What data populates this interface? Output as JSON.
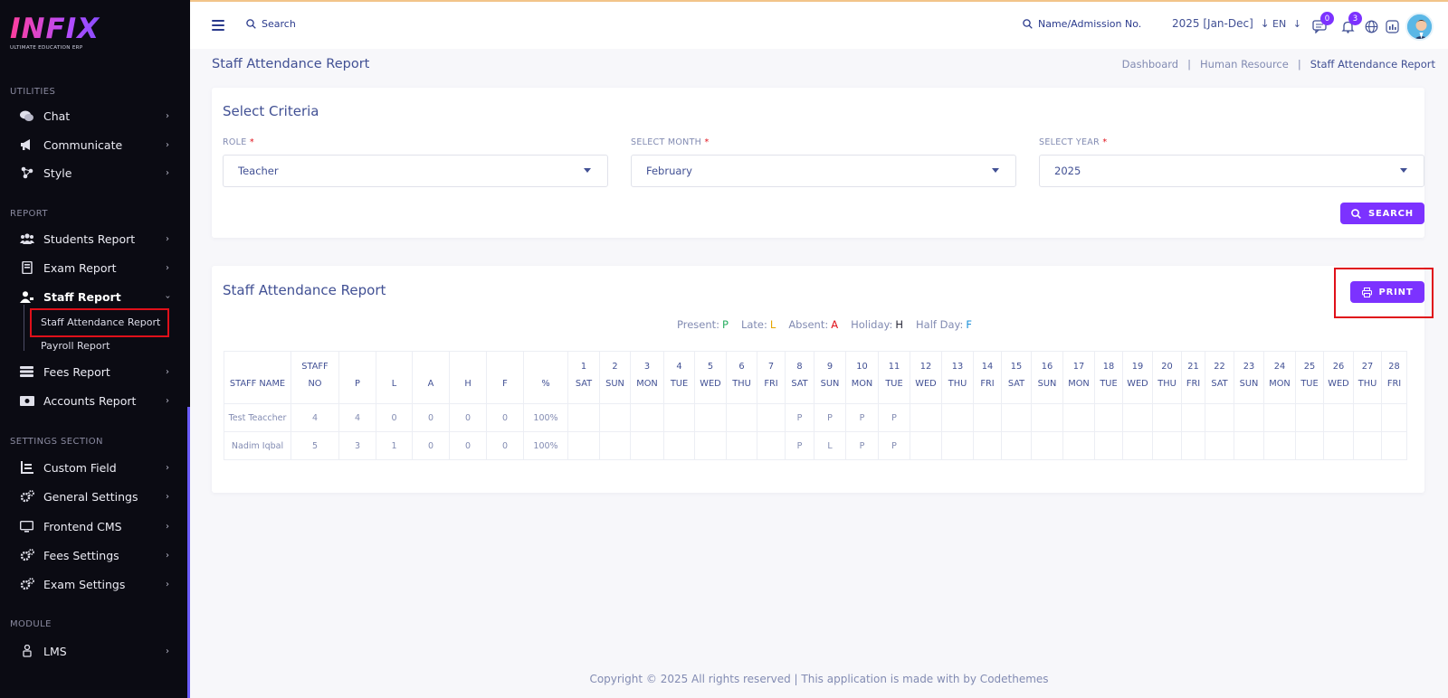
{
  "sidebar": {
    "logo_text": "INFIX",
    "logo_sub": "ULTIMATE EDUCATION ERP",
    "sections": {
      "utilities": "UTILITIES",
      "report": "REPORT",
      "settings": "SETTINGS SECTION",
      "module": "MODULE"
    },
    "items": {
      "chat": "Chat",
      "communicate": "Communicate",
      "style": "Style",
      "students_report": "Students Report",
      "exam_report": "Exam Report",
      "staff_report": "Staff Report",
      "staff_attendance_report": "Staff Attendance Report",
      "payroll_report": "Payroll Report",
      "fees_report": "Fees Report",
      "accounts_report": "Accounts Report",
      "custom_field": "Custom Field",
      "general_settings": "General Settings",
      "frontend_cms": "Frontend CMS",
      "fees_settings": "Fees Settings",
      "exam_settings": "Exam Settings",
      "lms": "LMS"
    }
  },
  "header": {
    "search_placeholder": "Search",
    "admission_placeholder": "Name/Admission No.",
    "year": "2025 [Jan-Dec]",
    "lang": "EN",
    "chat_badge": "0",
    "notif_badge": "3"
  },
  "page": {
    "title": "Staff Attendance Report",
    "breadcrumb": [
      "Dashboard",
      "Human Resource",
      "Staff Attendance Report"
    ]
  },
  "criteria": {
    "title": "Select Criteria",
    "role_label": "ROLE",
    "role_value": "Teacher",
    "month_label": "SELECT MONTH",
    "month_value": "February",
    "year_label": "SELECT YEAR",
    "year_value": "2025",
    "search_button": "SEARCH"
  },
  "report": {
    "title": "Staff Attendance Report",
    "print_button": "PRINT",
    "legend": [
      {
        "label": "Present:",
        "code": "P",
        "color": "#27ae60"
      },
      {
        "label": "Late:",
        "code": "L",
        "color": "#e6a600"
      },
      {
        "label": "Absent:",
        "code": "A",
        "color": "#e0101a"
      },
      {
        "label": "Holiday:",
        "code": "H",
        "color": "#2a2a3a"
      },
      {
        "label": "Half Day:",
        "code": "F",
        "color": "#1a8fd8"
      }
    ],
    "columns": [
      "STAFF NAME",
      "STAFF NO",
      "P",
      "L",
      "A",
      "H",
      "F",
      "%"
    ],
    "days": [
      {
        "d": "1",
        "w": "SAT"
      },
      {
        "d": "2",
        "w": "SUN"
      },
      {
        "d": "3",
        "w": "MON"
      },
      {
        "d": "4",
        "w": "TUE"
      },
      {
        "d": "5",
        "w": "WED"
      },
      {
        "d": "6",
        "w": "THU"
      },
      {
        "d": "7",
        "w": "FRI"
      },
      {
        "d": "8",
        "w": "SAT"
      },
      {
        "d": "9",
        "w": "SUN"
      },
      {
        "d": "10",
        "w": "MON"
      },
      {
        "d": "11",
        "w": "TUE"
      },
      {
        "d": "12",
        "w": "WED"
      },
      {
        "d": "13",
        "w": "THU"
      },
      {
        "d": "14",
        "w": "FRI"
      },
      {
        "d": "15",
        "w": "SAT"
      },
      {
        "d": "16",
        "w": "SUN"
      },
      {
        "d": "17",
        "w": "MON"
      },
      {
        "d": "18",
        "w": "TUE"
      },
      {
        "d": "19",
        "w": "WED"
      },
      {
        "d": "20",
        "w": "THU"
      },
      {
        "d": "21",
        "w": "FRI"
      },
      {
        "d": "22",
        "w": "SAT"
      },
      {
        "d": "23",
        "w": "SUN"
      },
      {
        "d": "24",
        "w": "MON"
      },
      {
        "d": "25",
        "w": "TUE"
      },
      {
        "d": "26",
        "w": "WED"
      },
      {
        "d": "27",
        "w": "THU"
      },
      {
        "d": "28",
        "w": "FRI"
      }
    ],
    "rows": [
      {
        "name": "Test Teaccher",
        "no": "4",
        "p": "4",
        "l": "0",
        "a": "0",
        "h": "0",
        "f": "0",
        "pct": "100%",
        "att": [
          "",
          "",
          "",
          "",
          "",
          "",
          "",
          "P",
          "P",
          "P",
          "P",
          "",
          "",
          "",
          "",
          "",
          "",
          "",
          "",
          "",
          "",
          "",
          "",
          "",
          "",
          "",
          "",
          ""
        ]
      },
      {
        "name": "Nadim Iqbal",
        "no": "5",
        "p": "3",
        "l": "1",
        "a": "0",
        "h": "0",
        "f": "0",
        "pct": "100%",
        "att": [
          "",
          "",
          "",
          "",
          "",
          "",
          "",
          "P",
          "L",
          "P",
          "P",
          "",
          "",
          "",
          "",
          "",
          "",
          "",
          "",
          "",
          "",
          "",
          "",
          "",
          "",
          "",
          "",
          ""
        ]
      }
    ]
  },
  "footer": "Copyright © 2025 All rights reserved | This application is made with by Codethemes"
}
